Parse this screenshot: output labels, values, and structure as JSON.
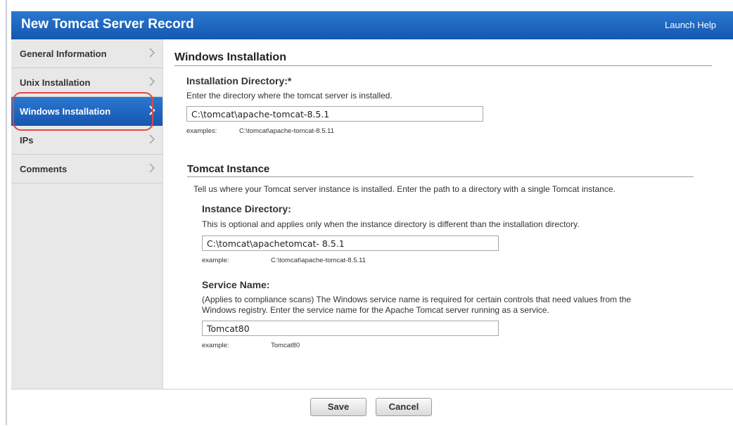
{
  "dialog": {
    "title": "New Tomcat Server Record",
    "help_link": "Launch Help"
  },
  "sidebar": {
    "items": [
      {
        "label": "General Information",
        "active": false
      },
      {
        "label": "Unix Installation",
        "active": false
      },
      {
        "label": "Windows Installation",
        "active": true
      },
      {
        "label": "IPs",
        "active": false
      },
      {
        "label": "Comments",
        "active": false
      }
    ]
  },
  "main": {
    "section_title": "Windows Installation",
    "installation_directory": {
      "label": "Installation Directory:*",
      "description": "Enter the directory where the tomcat server is installed.",
      "value": "C:\\tomcat\\apache-tomcat-8.5.1",
      "example_label": "examples:",
      "example_value": "C:\\tomcat\\apache-tomcat-8.5.11"
    },
    "tomcat_instance": {
      "title": "Tomcat Instance",
      "description": "Tell us where your Tomcat server instance is installed. Enter the path to a directory with a single Tomcat instance.",
      "instance_directory": {
        "label": "Instance Directory:",
        "description": "This is optional and applies only when the instance directory is different than the installation directory.",
        "value": "C:\\tomcat\\apachetomcat- 8.5.1",
        "example_label": "example:",
        "example_value": "C:\\tomcat\\apache-tomcat-8.5.11"
      },
      "service_name": {
        "label": "Service Name:",
        "description_line1": "(Applies to compliance scans) The Windows service name is required for certain controls that need values from the",
        "description_line2": "Windows registry. Enter the service name for the Apache Tomcat server running as a service.",
        "value": "Tomcat80",
        "example_label": "example:",
        "example_value": "Tomcat80"
      }
    }
  },
  "footer": {
    "save_label": "Save",
    "cancel_label": "Cancel"
  },
  "colors": {
    "title_bar": "#1e68c0",
    "active_nav": "#1e68c0",
    "highlight_ring": "#e0483e"
  }
}
